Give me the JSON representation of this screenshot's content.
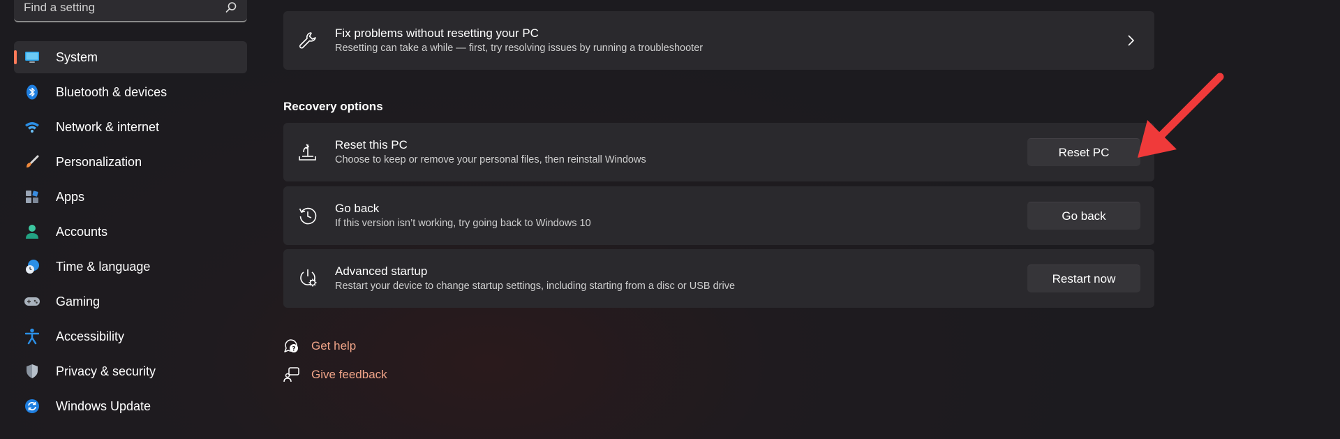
{
  "search": {
    "placeholder": "Find a setting",
    "icon": "search-icon"
  },
  "sidebar": {
    "items": [
      {
        "label": "System",
        "icon": "system-icon",
        "active": true
      },
      {
        "label": "Bluetooth & devices",
        "icon": "bluetooth-icon"
      },
      {
        "label": "Network & internet",
        "icon": "wifi-icon"
      },
      {
        "label": "Personalization",
        "icon": "brush-icon"
      },
      {
        "label": "Apps",
        "icon": "apps-icon"
      },
      {
        "label": "Accounts",
        "icon": "person-icon"
      },
      {
        "label": "Time & language",
        "icon": "clock-globe-icon"
      },
      {
        "label": "Gaming",
        "icon": "gamepad-icon"
      },
      {
        "label": "Accessibility",
        "icon": "accessibility-icon"
      },
      {
        "label": "Privacy & security",
        "icon": "shield-icon"
      },
      {
        "label": "Windows Update",
        "icon": "update-icon"
      }
    ],
    "accent_color": "#ff7a59"
  },
  "troubleshoot": {
    "title": "Fix problems without resetting your PC",
    "description": "Resetting can take a while — first, try resolving issues by running a troubleshooter",
    "icon": "wrench-icon"
  },
  "recovery": {
    "section_title": "Recovery options",
    "items": [
      {
        "title": "Reset this PC",
        "description": "Choose to keep or remove your personal files, then reinstall Windows",
        "button": "Reset PC",
        "icon": "reset-icon"
      },
      {
        "title": "Go back",
        "description": "If this version isn’t working, try going back to Windows 10",
        "button": "Go back",
        "icon": "history-icon"
      },
      {
        "title": "Advanced startup",
        "description": "Restart your device to change startup settings, including starting from a disc or USB drive",
        "button": "Restart now",
        "icon": "advanced-startup-icon"
      }
    ]
  },
  "links": {
    "help": "Get help",
    "feedback": "Give feedback",
    "color": "#f0a488"
  },
  "annotation": {
    "arrow_color": "#f03a3a"
  }
}
